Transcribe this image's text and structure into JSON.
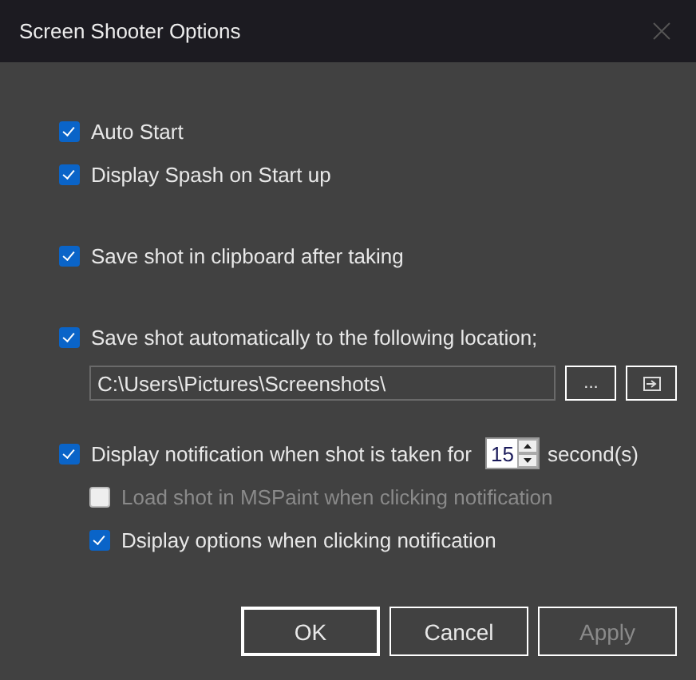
{
  "window": {
    "title": "Screen Shooter Options"
  },
  "groups": [
    {
      "items": [
        {
          "kind": "checkbox",
          "label": "Auto Start",
          "checked": true
        },
        {
          "kind": "checkbox",
          "label": "Display Spash on Start up",
          "checked": true
        }
      ]
    },
    {
      "items": [
        {
          "kind": "checkbox",
          "label": "Save shot in clipboard after taking",
          "checked": true
        }
      ]
    },
    {
      "items": [
        {
          "kind": "checkbox",
          "label": "Save shot automatically to the following location;",
          "checked": true
        },
        {
          "kind": "path",
          "value": "C:\\Users\\Pictures\\Screenshots\\",
          "browse": "..."
        }
      ]
    },
    {
      "items": [
        {
          "kind": "timed",
          "label": "Display notification when shot is taken for",
          "value": "15",
          "unit": "second(s)",
          "checked": true
        },
        {
          "kind": "sub",
          "label": "Load shot in MSPaint when clicking notification",
          "checked": false,
          "disabled": true
        },
        {
          "kind": "sub",
          "label": "Dsiplay options when clicking notification",
          "checked": true,
          "disabled": false
        }
      ]
    }
  ],
  "buttons": [
    {
      "label": "OK",
      "default": true,
      "disabled": false
    },
    {
      "label": "Cancel",
      "default": false,
      "disabled": false
    },
    {
      "label": "Apply",
      "default": false,
      "disabled": true
    }
  ]
}
